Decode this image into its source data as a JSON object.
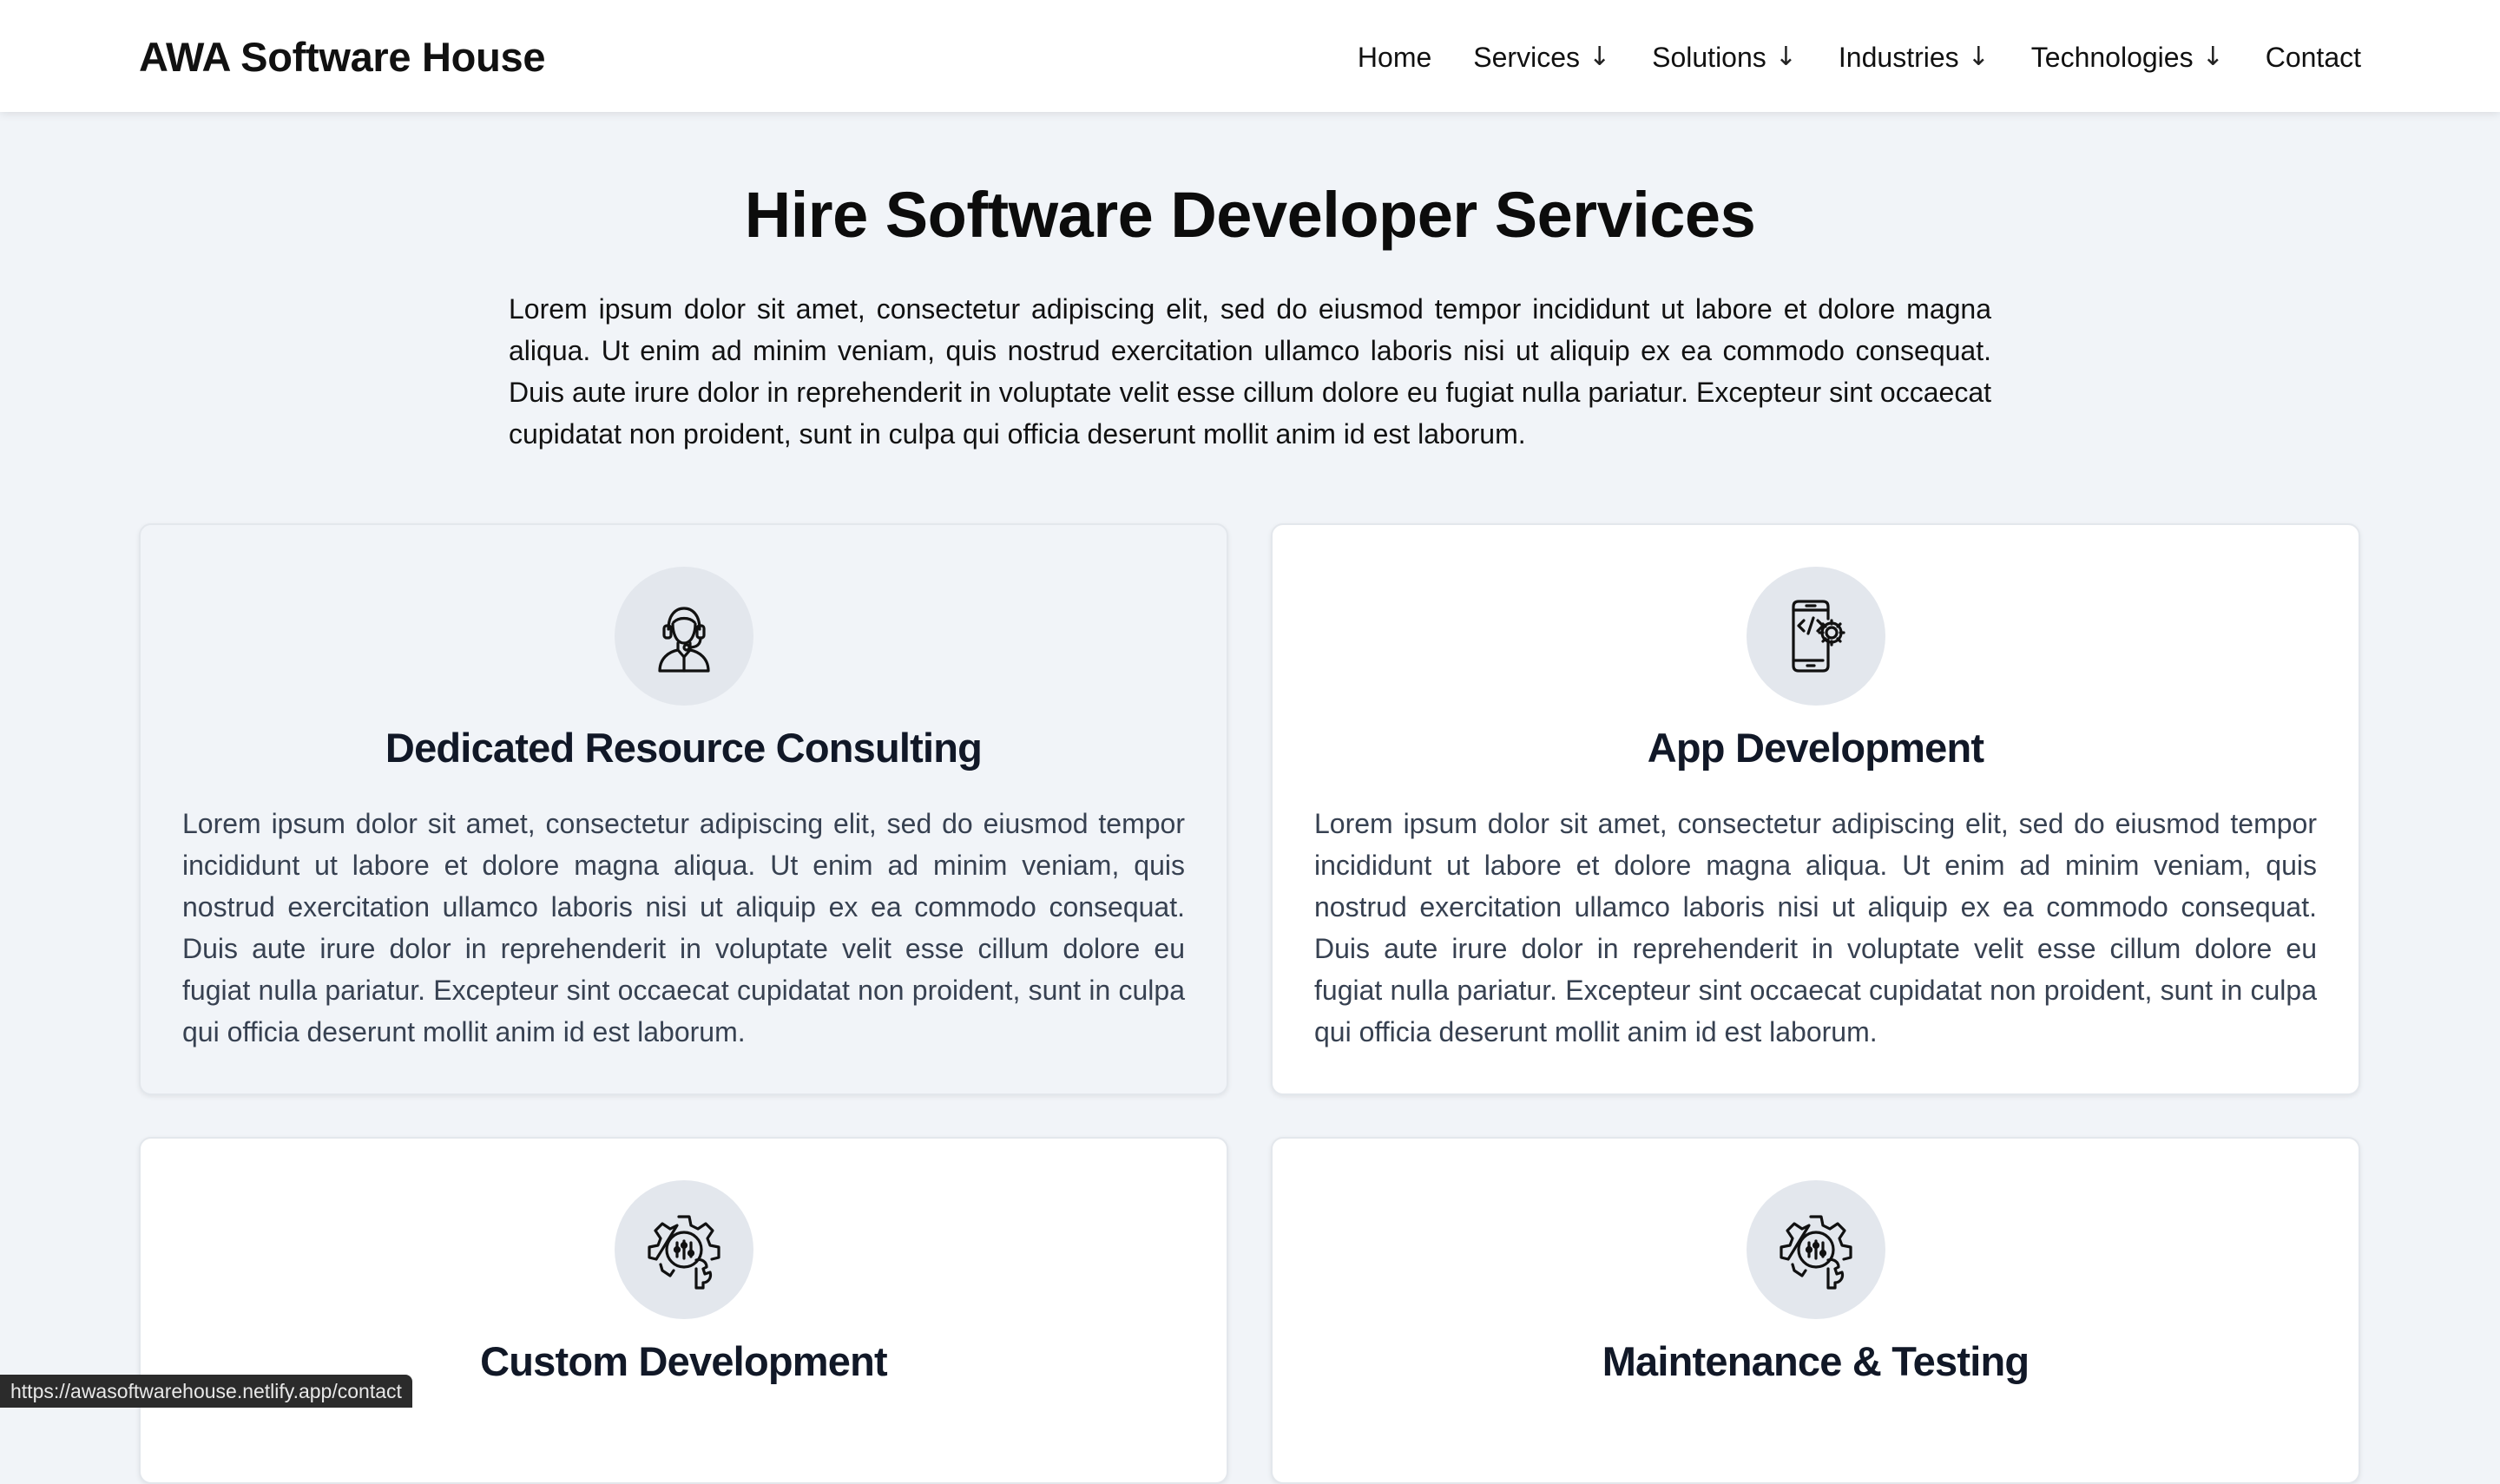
{
  "header": {
    "brand": "AWA Software House",
    "nav": [
      {
        "label": "Home",
        "has_dropdown": false
      },
      {
        "label": "Services",
        "has_dropdown": true
      },
      {
        "label": "Solutions",
        "has_dropdown": true
      },
      {
        "label": "Industries",
        "has_dropdown": true
      },
      {
        "label": "Technologies",
        "has_dropdown": true
      },
      {
        "label": "Contact",
        "has_dropdown": false
      }
    ],
    "dropdown_arrow": "↓"
  },
  "hero": {
    "title": "Hire Software Developer Services",
    "text": "Lorem ipsum dolor sit amet, consectetur adipiscing elit, sed do eiusmod tempor incididunt ut labore et dolore magna aliqua. Ut enim ad minim veniam, quis nostrud exercitation ullamco laboris nisi ut aliquip ex ea commodo consequat. Duis aute irure dolor in reprehenderit in voluptate velit esse cillum dolore eu fugiat nulla pariatur. Excepteur sint occaecat cupidatat non proident, sunt in culpa qui officia deserunt mollit anim id est laborum."
  },
  "cards": [
    {
      "title": "Dedicated Resource Consulting",
      "icon": "support-agent-icon",
      "text": "Lorem ipsum dolor sit amet, consectetur adipiscing elit, sed do eiusmod tempor incididunt ut labore et dolore magna aliqua. Ut enim ad minim veniam, quis nostrud exercitation ullamco laboris nisi ut aliquip ex ea commodo consequat. Duis aute irure dolor in reprehenderit in voluptate velit esse cillum dolore eu fugiat nulla pariatur. Excepteur sint occaecat cupidatat non proident, sunt in culpa qui officia deserunt mollit anim id est laborum."
    },
    {
      "title": "App Development",
      "icon": "mobile-code-gear-icon",
      "text": "Lorem ipsum dolor sit amet, consectetur adipiscing elit, sed do eiusmod tempor incididunt ut labore et dolore magna aliqua. Ut enim ad minim veniam, quis nostrud exercitation ullamco laboris nisi ut aliquip ex ea commodo consequat. Duis aute irure dolor in reprehenderit in voluptate velit esse cillum dolore eu fugiat nulla pariatur. Excepteur sint occaecat cupidatat non proident, sunt in culpa qui officia deserunt mollit anim id est laborum."
    },
    {
      "title": "Custom Development",
      "icon": "gear-wrench-icon",
      "text": ""
    },
    {
      "title": "Maintenance & Testing",
      "icon": "gear-wrench-icon",
      "text": ""
    }
  ],
  "status_bar": {
    "url": "https://awasoftwarehouse.netlify.app/contact"
  },
  "colors": {
    "page_background": "#f1f4f8",
    "header_background": "#ffffff",
    "card_background": "#ffffff",
    "icon_circle": "#e3e7ed",
    "card_title": "#111827",
    "card_text": "#374151"
  }
}
